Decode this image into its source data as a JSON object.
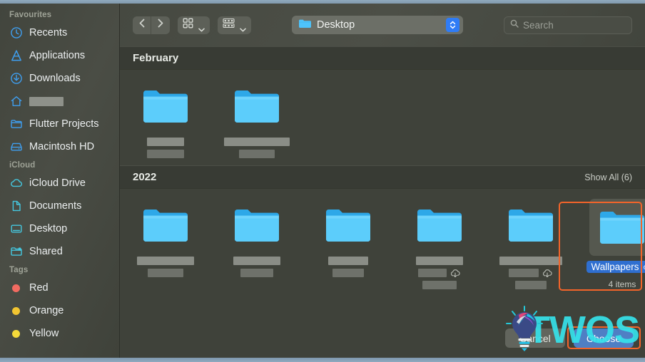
{
  "window": {
    "title": "Desktop"
  },
  "toolbar": {
    "back_icon": "chevron-left-icon",
    "forward_icon": "chevron-right-icon",
    "view_icon": "icon-view-grid-icon",
    "group_icon": "group-by-rows-icon",
    "path_label": "Desktop",
    "path_folder_icon": "folder-icon",
    "stepper_icon": "chevron-up-down-icon",
    "search": {
      "icon": "search-icon",
      "placeholder": "Search",
      "value": ""
    }
  },
  "sidebar": {
    "sections": [
      {
        "header": "Favourites",
        "items": [
          {
            "label": "Recents",
            "icon": "clock-icon",
            "redacted": false
          },
          {
            "label": "Applications",
            "icon": "applications-icon",
            "redacted": false
          },
          {
            "label": "Downloads",
            "icon": "download-icon",
            "redacted": false
          },
          {
            "label": "",
            "icon": "home-icon",
            "redacted": true
          },
          {
            "label": "Flutter Projects",
            "icon": "folder-icon",
            "redacted": false
          },
          {
            "label": "Macintosh HD",
            "icon": "harddisk-icon",
            "redacted": false
          }
        ]
      },
      {
        "header": "iCloud",
        "items": [
          {
            "label": "iCloud Drive",
            "icon": "cloud-icon",
            "redacted": false
          },
          {
            "label": "Documents",
            "icon": "document-icon",
            "redacted": false
          },
          {
            "label": "Desktop",
            "icon": "desktop-icon",
            "redacted": false
          },
          {
            "label": "Shared",
            "icon": "shared-folder-icon",
            "redacted": false
          }
        ]
      },
      {
        "header": "Tags",
        "items": [
          {
            "label": "Red",
            "icon": "tag-dot-icon",
            "color": "#f26b61",
            "redacted": false
          },
          {
            "label": "Orange",
            "icon": "tag-dot-icon",
            "color": "#f2c531",
            "redacted": false
          },
          {
            "label": "Yellow",
            "icon": "tag-dot-icon",
            "color": "#f4d93a",
            "redacted": false
          }
        ]
      }
    ]
  },
  "content": {
    "groups": [
      {
        "title": "February",
        "show_all": "",
        "items": [
          {
            "name": "",
            "redacted": true,
            "name_widths": [
              52,
              52
            ],
            "subtitle": "",
            "cloud": false,
            "selected": false
          },
          {
            "name": "",
            "redacted": true,
            "name_widths": [
              92,
              50
            ],
            "subtitle": "",
            "cloud": false,
            "selected": false
          }
        ]
      },
      {
        "title": "2022",
        "show_all": "Show All (6)",
        "items": [
          {
            "name": "",
            "redacted": true,
            "name_widths": [
              80,
              50
            ],
            "subtitle": "",
            "cloud": false,
            "selected": false
          },
          {
            "name": "",
            "redacted": true,
            "name_widths": [
              66,
              46
            ],
            "subtitle": "",
            "cloud": false,
            "selected": false
          },
          {
            "name": "",
            "redacted": true,
            "name_widths": [
              56,
              44
            ],
            "subtitle": "",
            "cloud": false,
            "selected": false
          },
          {
            "name": "",
            "redacted": true,
            "name_widths": [
              66,
              40,
              48
            ],
            "subtitle": "",
            "cloud": true,
            "selected": false
          },
          {
            "name": "",
            "redacted": true,
            "name_widths": [
              88,
              42,
              44
            ],
            "subtitle": "",
            "cloud": true,
            "selected": false
          },
          {
            "name": "Wallpapers",
            "redacted": false,
            "name_widths": [],
            "subtitle": "4 items",
            "cloud": true,
            "selected": true
          }
        ]
      }
    ]
  },
  "footer": {
    "cancel_label": "Cancel",
    "choose_label": "Choose"
  },
  "watermark": {
    "text": "TWOS",
    "bulb_icon": "lightbulb-icon"
  },
  "annotations": {
    "color": "#f4642a",
    "boxes": [
      "selected-folder-highlight",
      "choose-button-highlight"
    ]
  },
  "colors": {
    "accent_blue": "#2f7cf6",
    "folder_blue": "#4ec3fa",
    "selection_blue": "#2f6fd0",
    "window_bg": "#3f423a",
    "sidebar_bg": "#45483f",
    "annotation": "#f4642a",
    "watermark": "#36e2ea"
  }
}
